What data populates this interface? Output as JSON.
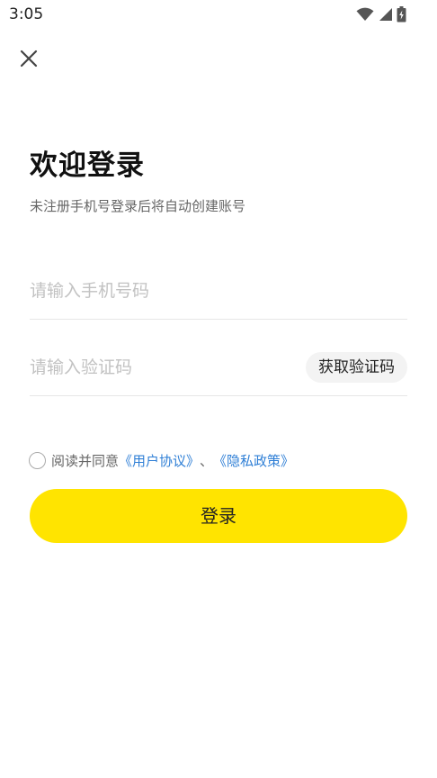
{
  "status_bar": {
    "time": "3:05",
    "icons": [
      "wifi-icon",
      "cell-signal-icon",
      "battery-icon"
    ]
  },
  "header": {
    "close_icon": "close-icon",
    "title": "欢迎登录",
    "subtitle": "未注册手机号登录后将自动创建账号"
  },
  "form": {
    "phone_placeholder": "请输入手机号码",
    "phone_value": "",
    "code_placeholder": "请输入验证码",
    "code_value": "",
    "get_code_label": "获取验证码"
  },
  "agreement": {
    "checked": false,
    "prefix": "阅读并同意",
    "user_agreement": "《用户协议》",
    "separator": "、",
    "privacy_policy": "《隐私政策》"
  },
  "login_label": "登录",
  "colors": {
    "accent": "#ffe400",
    "link": "#2f7fd6"
  }
}
